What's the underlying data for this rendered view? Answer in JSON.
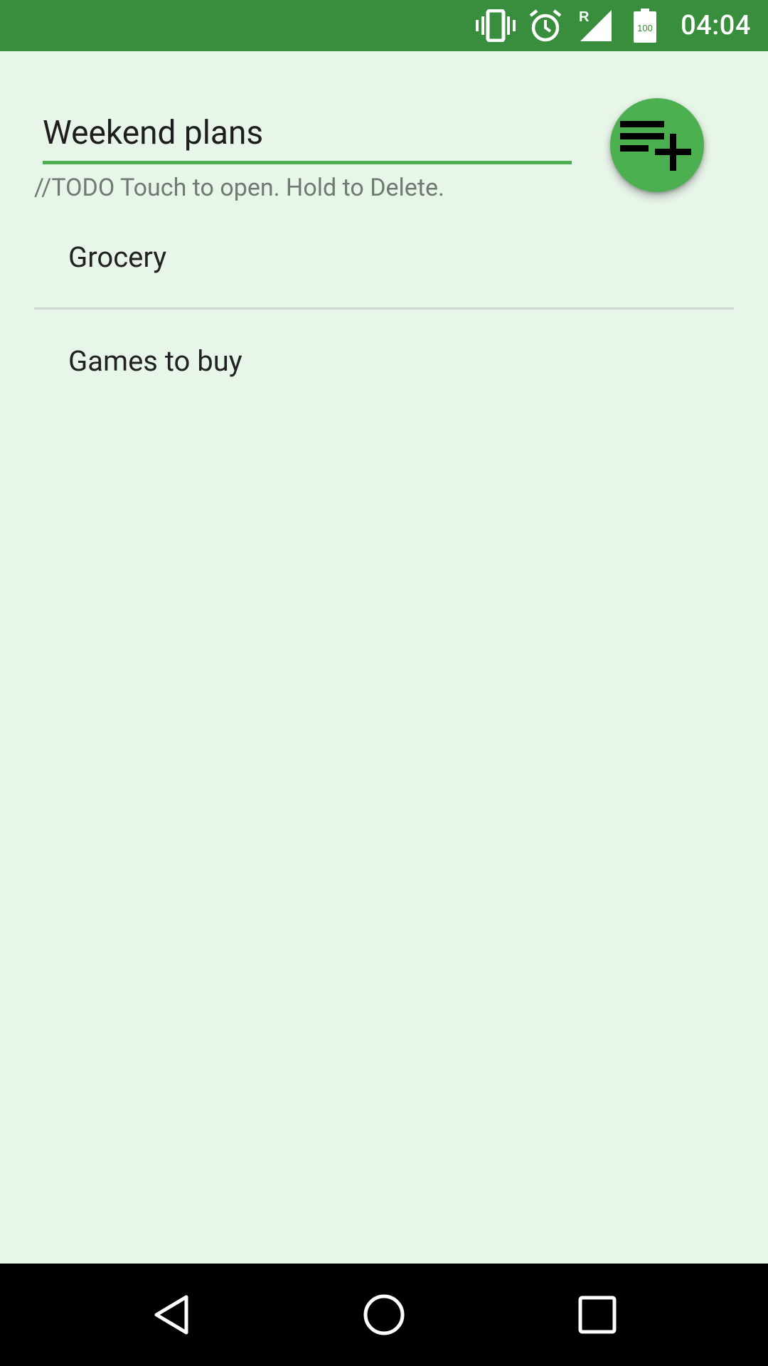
{
  "status_bar": {
    "time": "04:04",
    "icons": [
      "vibrate-icon",
      "alarm-icon",
      "roaming-signal-icon",
      "battery-icon"
    ],
    "battery_text": "100",
    "roaming_text": "R",
    "color": "#388e3c"
  },
  "header": {
    "list_title_value": "Weekend plans",
    "hint": "//TODO Touch to open. Hold to Delete.",
    "fab_icon": "playlist-add-icon",
    "accent": "#4caf50"
  },
  "lists": [
    {
      "label": "Grocery"
    },
    {
      "label": "Games to buy"
    }
  ],
  "nav_bar": {
    "buttons": [
      "back-icon",
      "home-icon",
      "recents-icon"
    ]
  },
  "colors": {
    "background": "#e8f5e9",
    "status_bar": "#388e3c",
    "accent": "#4caf50"
  }
}
